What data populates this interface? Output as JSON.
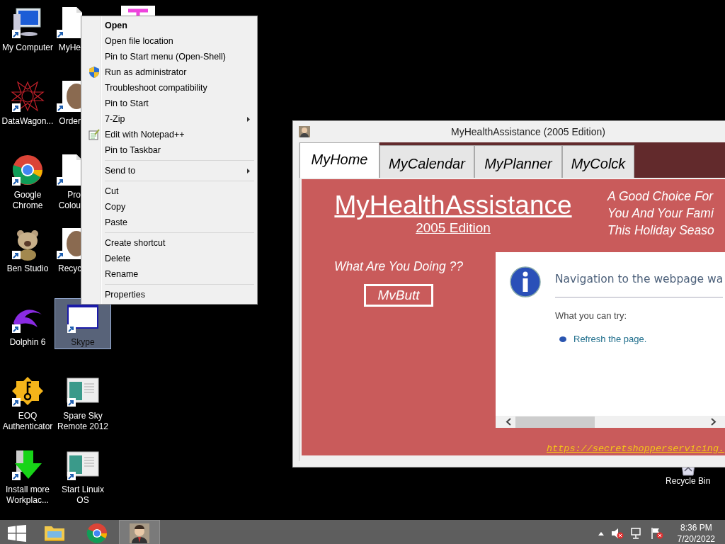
{
  "desktop": {
    "icons": [
      {
        "kind": "computer",
        "label": "My Computer",
        "selected": false
      },
      {
        "kind": "star",
        "label": "DataWagon...",
        "selected": false
      },
      {
        "kind": "chrome",
        "label": "Google Chrome",
        "selected": false
      },
      {
        "kind": "bear",
        "label": "Ben Studio",
        "selected": false
      },
      {
        "kind": "dolphin",
        "label": "Dolphin 6",
        "selected": false
      },
      {
        "kind": "key",
        "label": "EOQ Authenticator",
        "selected": false
      },
      {
        "kind": "download",
        "label": "Install more Workplac...",
        "selected": false
      },
      {
        "kind": "file",
        "label": "MyHe",
        "selected": false
      },
      {
        "kind": "photo",
        "label": "Order",
        "selected": false
      },
      {
        "kind": "file",
        "label": "Pro Colou",
        "selected": false
      },
      {
        "kind": "photo",
        "label": "Recyc",
        "selected": false
      },
      {
        "kind": "window",
        "label": "Skype",
        "selected": true
      },
      {
        "kind": "app",
        "label": "Spare Sky Remote 2012",
        "selected": false
      },
      {
        "kind": "app",
        "label": "Start Linuix OS",
        "selected": false
      },
      {
        "kind": "pink",
        "selected": false
      }
    ],
    "recycle_bin": {
      "label": "Recycle Bin"
    }
  },
  "context_menu": {
    "items": [
      {
        "kind": "item",
        "label": "Open",
        "default": true,
        "submenu": false
      },
      {
        "kind": "item",
        "label": "Open file location",
        "default": false,
        "submenu": false
      },
      {
        "kind": "item",
        "label": "Pin to Start menu (Open-Shell)",
        "default": false,
        "submenu": false
      },
      {
        "kind": "shield",
        "label": "Run as administrator",
        "default": false,
        "submenu": false
      },
      {
        "kind": "item",
        "label": "Troubleshoot compatibility",
        "default": false,
        "submenu": false
      },
      {
        "kind": "item",
        "label": "Pin to Start",
        "default": false,
        "submenu": false
      },
      {
        "kind": "item",
        "label": "7-Zip",
        "default": false,
        "submenu": true
      },
      {
        "kind": "notepad",
        "label": "Edit with Notepad++",
        "default": false,
        "submenu": false
      },
      {
        "kind": "item",
        "label": "Pin to Taskbar",
        "default": false,
        "submenu": false
      },
      {
        "kind": "separator"
      },
      {
        "kind": "item",
        "label": "Send to",
        "default": false,
        "submenu": true
      },
      {
        "kind": "separator"
      },
      {
        "kind": "item",
        "label": "Cut",
        "default": false,
        "submenu": false
      },
      {
        "kind": "item",
        "label": "Copy",
        "default": false,
        "submenu": false
      },
      {
        "kind": "item",
        "label": "Paste",
        "default": false,
        "submenu": false
      },
      {
        "kind": "separator"
      },
      {
        "kind": "item",
        "label": "Create shortcut",
        "default": false,
        "submenu": false
      },
      {
        "kind": "item",
        "label": "Delete",
        "default": false,
        "submenu": false
      },
      {
        "kind": "item",
        "label": "Rename",
        "default": false,
        "submenu": false
      },
      {
        "kind": "separator"
      },
      {
        "kind": "item",
        "label": "Properties",
        "default": false,
        "submenu": false
      }
    ]
  },
  "window": {
    "title": "MyHealthAssistance (2005 Edition)",
    "tabs": [
      {
        "label": "MyHome",
        "selected": true
      },
      {
        "label": "MyCalendar",
        "selected": false
      },
      {
        "label": "MyPlanner",
        "selected": false
      },
      {
        "label": "MyColck",
        "selected": false
      }
    ],
    "heading": "MyHealthAssistance",
    "edition": "2005 Edition",
    "tagline": [
      "A Good Choice For",
      "You And Your Fami",
      "This Holiday Seaso"
    ],
    "question": "What Are You Doing ??",
    "button": "MvButt",
    "error_page": {
      "title": "Navigation to the webpage wa",
      "subtitle": "What you can try:",
      "suggestions": [
        "Refresh the page."
      ]
    },
    "link": "https://secretshopperservicing."
  },
  "taskbar": {
    "apps": [
      {
        "kind": "explorer",
        "active": false
      },
      {
        "kind": "chrome",
        "active": false
      },
      {
        "kind": "person",
        "active": true
      }
    ],
    "time": "8:36 PM",
    "date": "7/20/2022"
  }
}
